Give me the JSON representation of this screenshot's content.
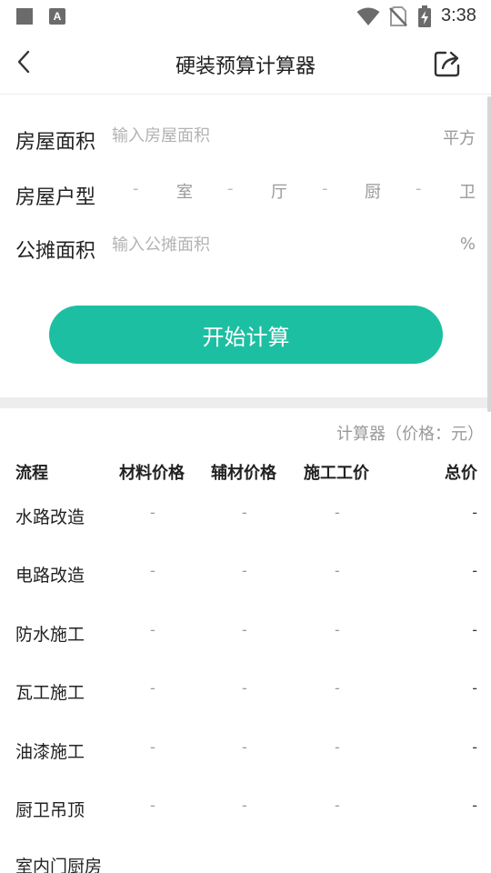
{
  "status_bar": {
    "time": "3:38",
    "icons": [
      "square-icon",
      "text-a-icon",
      "wifi-icon",
      "no-sim-icon",
      "battery-charging-icon"
    ],
    "a_glyph": "A"
  },
  "header": {
    "title": "硬装预算计算器",
    "back_icon": "chevron-left-icon",
    "share_icon": "share-icon"
  },
  "form": {
    "area": {
      "label": "房屋面积",
      "placeholder": "输入房屋面积",
      "value": "",
      "unit": "平方"
    },
    "house_type": {
      "label": "房屋户型",
      "fields": [
        {
          "value": "-",
          "unit": "室"
        },
        {
          "value": "-",
          "unit": "厅"
        },
        {
          "value": "-",
          "unit": "厨"
        },
        {
          "value": "-",
          "unit": "卫"
        }
      ]
    },
    "shared_area": {
      "label": "公摊面积",
      "placeholder": "输入公摊面积",
      "value": "",
      "unit": "%"
    }
  },
  "calculate_button": {
    "label": "开始计算",
    "color": "#1dbfa2"
  },
  "results": {
    "unit_note": "计算器（价格：元）",
    "columns": [
      "流程",
      "材料价格",
      "辅材价格",
      "施工工价",
      "总价"
    ],
    "rows": [
      {
        "name": "水路改造",
        "material": "-",
        "auxiliary": "-",
        "labor": "-",
        "total": "-"
      },
      {
        "name": "电路改造",
        "material": "-",
        "auxiliary": "-",
        "labor": "-",
        "total": "-"
      },
      {
        "name": "防水施工",
        "material": "-",
        "auxiliary": "-",
        "labor": "-",
        "total": "-"
      },
      {
        "name": "瓦工施工",
        "material": "-",
        "auxiliary": "-",
        "labor": "-",
        "total": "-"
      },
      {
        "name": "油漆施工",
        "material": "-",
        "auxiliary": "-",
        "labor": "-",
        "total": "-"
      },
      {
        "name": "厨卫吊顶",
        "material": "-",
        "auxiliary": "-",
        "labor": "-",
        "total": "-"
      },
      {
        "name": "室内门厨房",
        "material": "",
        "auxiliary": "",
        "labor": "",
        "total": ""
      }
    ]
  }
}
